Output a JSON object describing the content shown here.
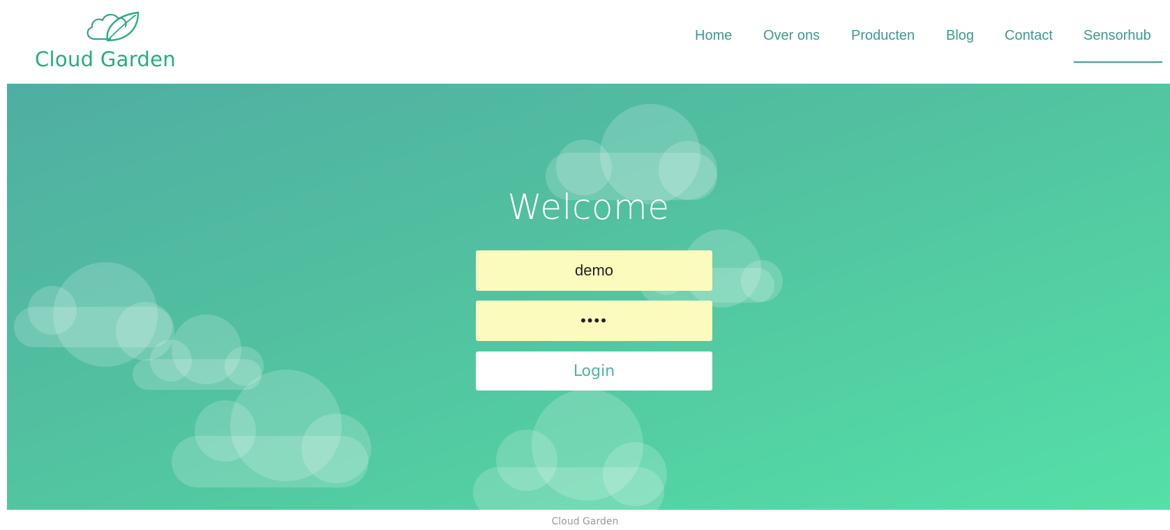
{
  "brand": {
    "name": "Cloud Garden",
    "icon": "cloud-leaf-icon",
    "color": "#21b07e"
  },
  "nav": {
    "items": [
      {
        "label": "Home"
      },
      {
        "label": "Over ons"
      },
      {
        "label": "Producten"
      },
      {
        "label": "Blog"
      },
      {
        "label": "Contact"
      },
      {
        "label": "Sensorhub",
        "active": true
      }
    ],
    "color": "#3c9a8f"
  },
  "hero": {
    "title": "Welcome",
    "username_value": "demo",
    "password_value": "demo",
    "login_label": "Login",
    "gradient_colors": [
      "#4faea2",
      "#52c2a0",
      "#54e0a7"
    ],
    "field_color": "#fbfbbe"
  },
  "footer": {
    "text": "Cloud Garden"
  }
}
